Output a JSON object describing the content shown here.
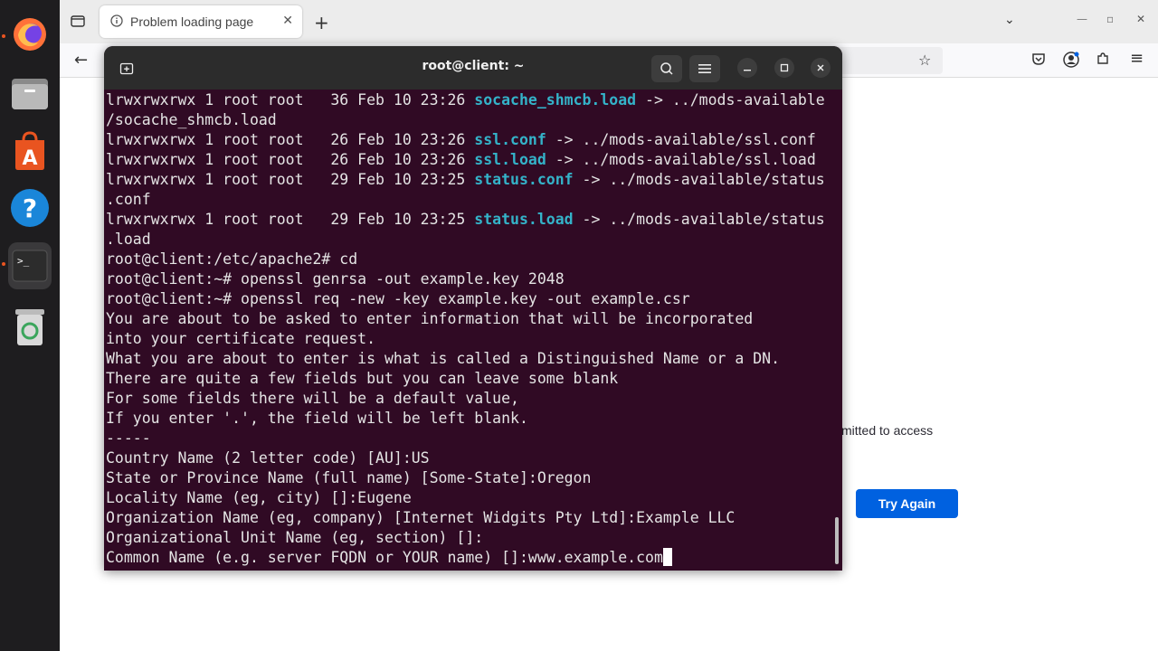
{
  "browser": {
    "tab_title": "Problem loading page",
    "page_message_fragment": "mitted to access",
    "try_again_label": "Try Again"
  },
  "terminal": {
    "title": "root@client: ~",
    "lines": [
      {
        "pre": "lrwxrwxrwx 1 root root   36 Feb 10 23:26 ",
        "name": "socache_shmcb.load",
        "post": " -> ../mods-available"
      },
      {
        "pre": "/socache_shmcb.load",
        "name": "",
        "post": ""
      },
      {
        "pre": "lrwxrwxrwx 1 root root   26 Feb 10 23:26 ",
        "name": "ssl.conf",
        "post": " -> ../mods-available/ssl.conf"
      },
      {
        "pre": "lrwxrwxrwx 1 root root   26 Feb 10 23:26 ",
        "name": "ssl.load",
        "post": " -> ../mods-available/ssl.load"
      },
      {
        "pre": "lrwxrwxrwx 1 root root   29 Feb 10 23:25 ",
        "name": "status.conf",
        "post": " -> ../mods-available/status"
      },
      {
        "pre": ".conf",
        "name": "",
        "post": ""
      },
      {
        "pre": "lrwxrwxrwx 1 root root   29 Feb 10 23:25 ",
        "name": "status.load",
        "post": " -> ../mods-available/status"
      },
      {
        "pre": ".load",
        "name": "",
        "post": ""
      },
      {
        "pre": "root@client:/etc/apache2# cd",
        "name": "",
        "post": ""
      },
      {
        "pre": "root@client:~# openssl genrsa -out example.key 2048",
        "name": "",
        "post": ""
      },
      {
        "pre": "root@client:~# openssl req -new -key example.key -out example.csr",
        "name": "",
        "post": ""
      },
      {
        "pre": "You are about to be asked to enter information that will be incorporated",
        "name": "",
        "post": ""
      },
      {
        "pre": "into your certificate request.",
        "name": "",
        "post": ""
      },
      {
        "pre": "What you are about to enter is what is called a Distinguished Name or a DN.",
        "name": "",
        "post": ""
      },
      {
        "pre": "There are quite a few fields but you can leave some blank",
        "name": "",
        "post": ""
      },
      {
        "pre": "For some fields there will be a default value,",
        "name": "",
        "post": ""
      },
      {
        "pre": "If you enter '.', the field will be left blank.",
        "name": "",
        "post": ""
      },
      {
        "pre": "-----",
        "name": "",
        "post": ""
      },
      {
        "pre": "Country Name (2 letter code) [AU]:US",
        "name": "",
        "post": ""
      },
      {
        "pre": "State or Province Name (full name) [Some-State]:Oregon",
        "name": "",
        "post": ""
      },
      {
        "pre": "Locality Name (eg, city) []:Eugene",
        "name": "",
        "post": ""
      },
      {
        "pre": "Organization Name (eg, company) [Internet Widgits Pty Ltd]:Example LLC",
        "name": "",
        "post": ""
      },
      {
        "pre": "Organizational Unit Name (eg, section) []:",
        "name": "",
        "post": ""
      },
      {
        "pre": "Common Name (e.g. server FQDN or YOUR name) []:www.example.com",
        "name": "",
        "post": ""
      }
    ]
  },
  "colors": {
    "terminal_bg": "#300a24",
    "symlink_name": "#34b3c9",
    "accent_button": "#0061e0",
    "dock_bg": "#1e1d1f"
  },
  "icons": {
    "dock": [
      "firefox-icon",
      "files-icon",
      "app-center-icon",
      "help-icon",
      "terminal-icon",
      "trash-icon"
    ],
    "terminal_header": [
      "new-tab-icon",
      "search-icon",
      "menu-icon",
      "minimize-icon",
      "maximize-icon",
      "close-icon"
    ],
    "browser": [
      "tab-list-icon",
      "info-icon",
      "close-tab-icon",
      "new-tab-icon",
      "back-icon",
      "bookmark-star-icon",
      "pocket-icon",
      "account-icon",
      "extensions-icon",
      "app-menu-icon"
    ]
  }
}
